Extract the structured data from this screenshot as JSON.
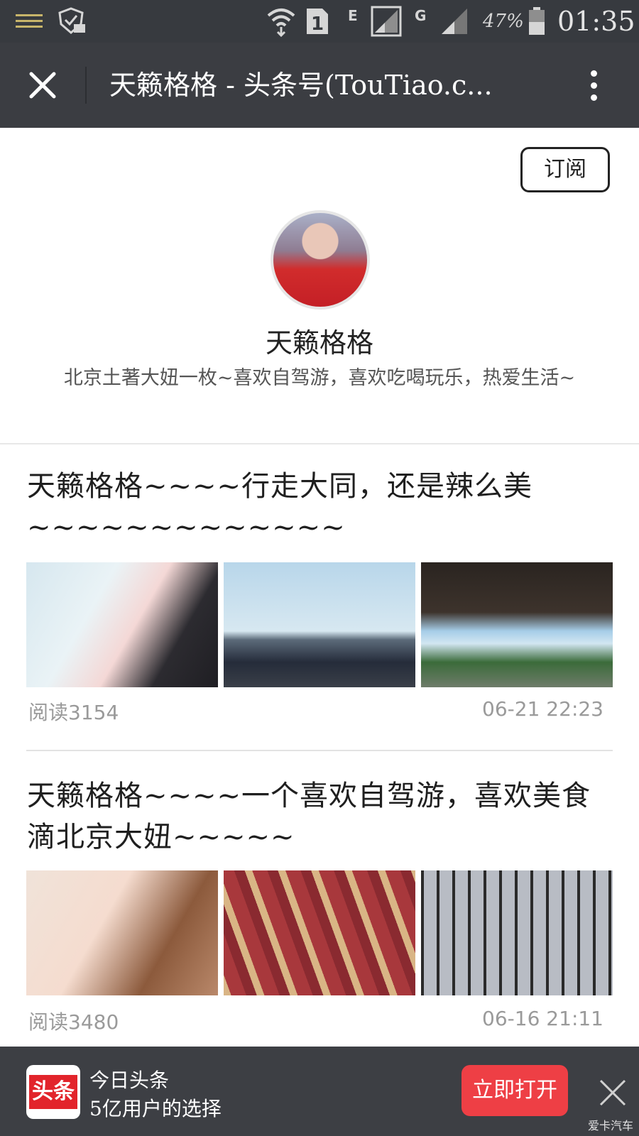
{
  "status_bar": {
    "battery_percent": "47%",
    "time": "01:35",
    "network_e": "E",
    "network_g": "G",
    "sim": "1"
  },
  "header": {
    "title": "天籁格格 - 头条号(TouTiao.c..."
  },
  "profile": {
    "subscribe_label": "订阅",
    "name": "天籁格格",
    "description": "北京土著大妞一枚~喜欢自驾游，喜欢吃喝玩乐，热爱生活~"
  },
  "articles": [
    {
      "title": "天籁格格~~~~行走大同，还是辣么美~~~~~~~~~~~~~",
      "reads": "阅读3154",
      "time": "06-21 22:23"
    },
    {
      "title": "天籁格格~~~~一个喜欢自驾游，喜欢美食滴北京大妞~~~~~",
      "reads": "阅读3480",
      "time": "06-16 21:11"
    }
  ],
  "banner": {
    "logo_text": "头条",
    "app_name": "今日头条",
    "slogan": "5亿用户的选择",
    "open_label": "立即打开",
    "watermark": "爱卡汽车"
  },
  "colors": {
    "header_bg": "#3b3d42",
    "accent_red": "#ee3f45",
    "logo_red": "#e2242b"
  }
}
